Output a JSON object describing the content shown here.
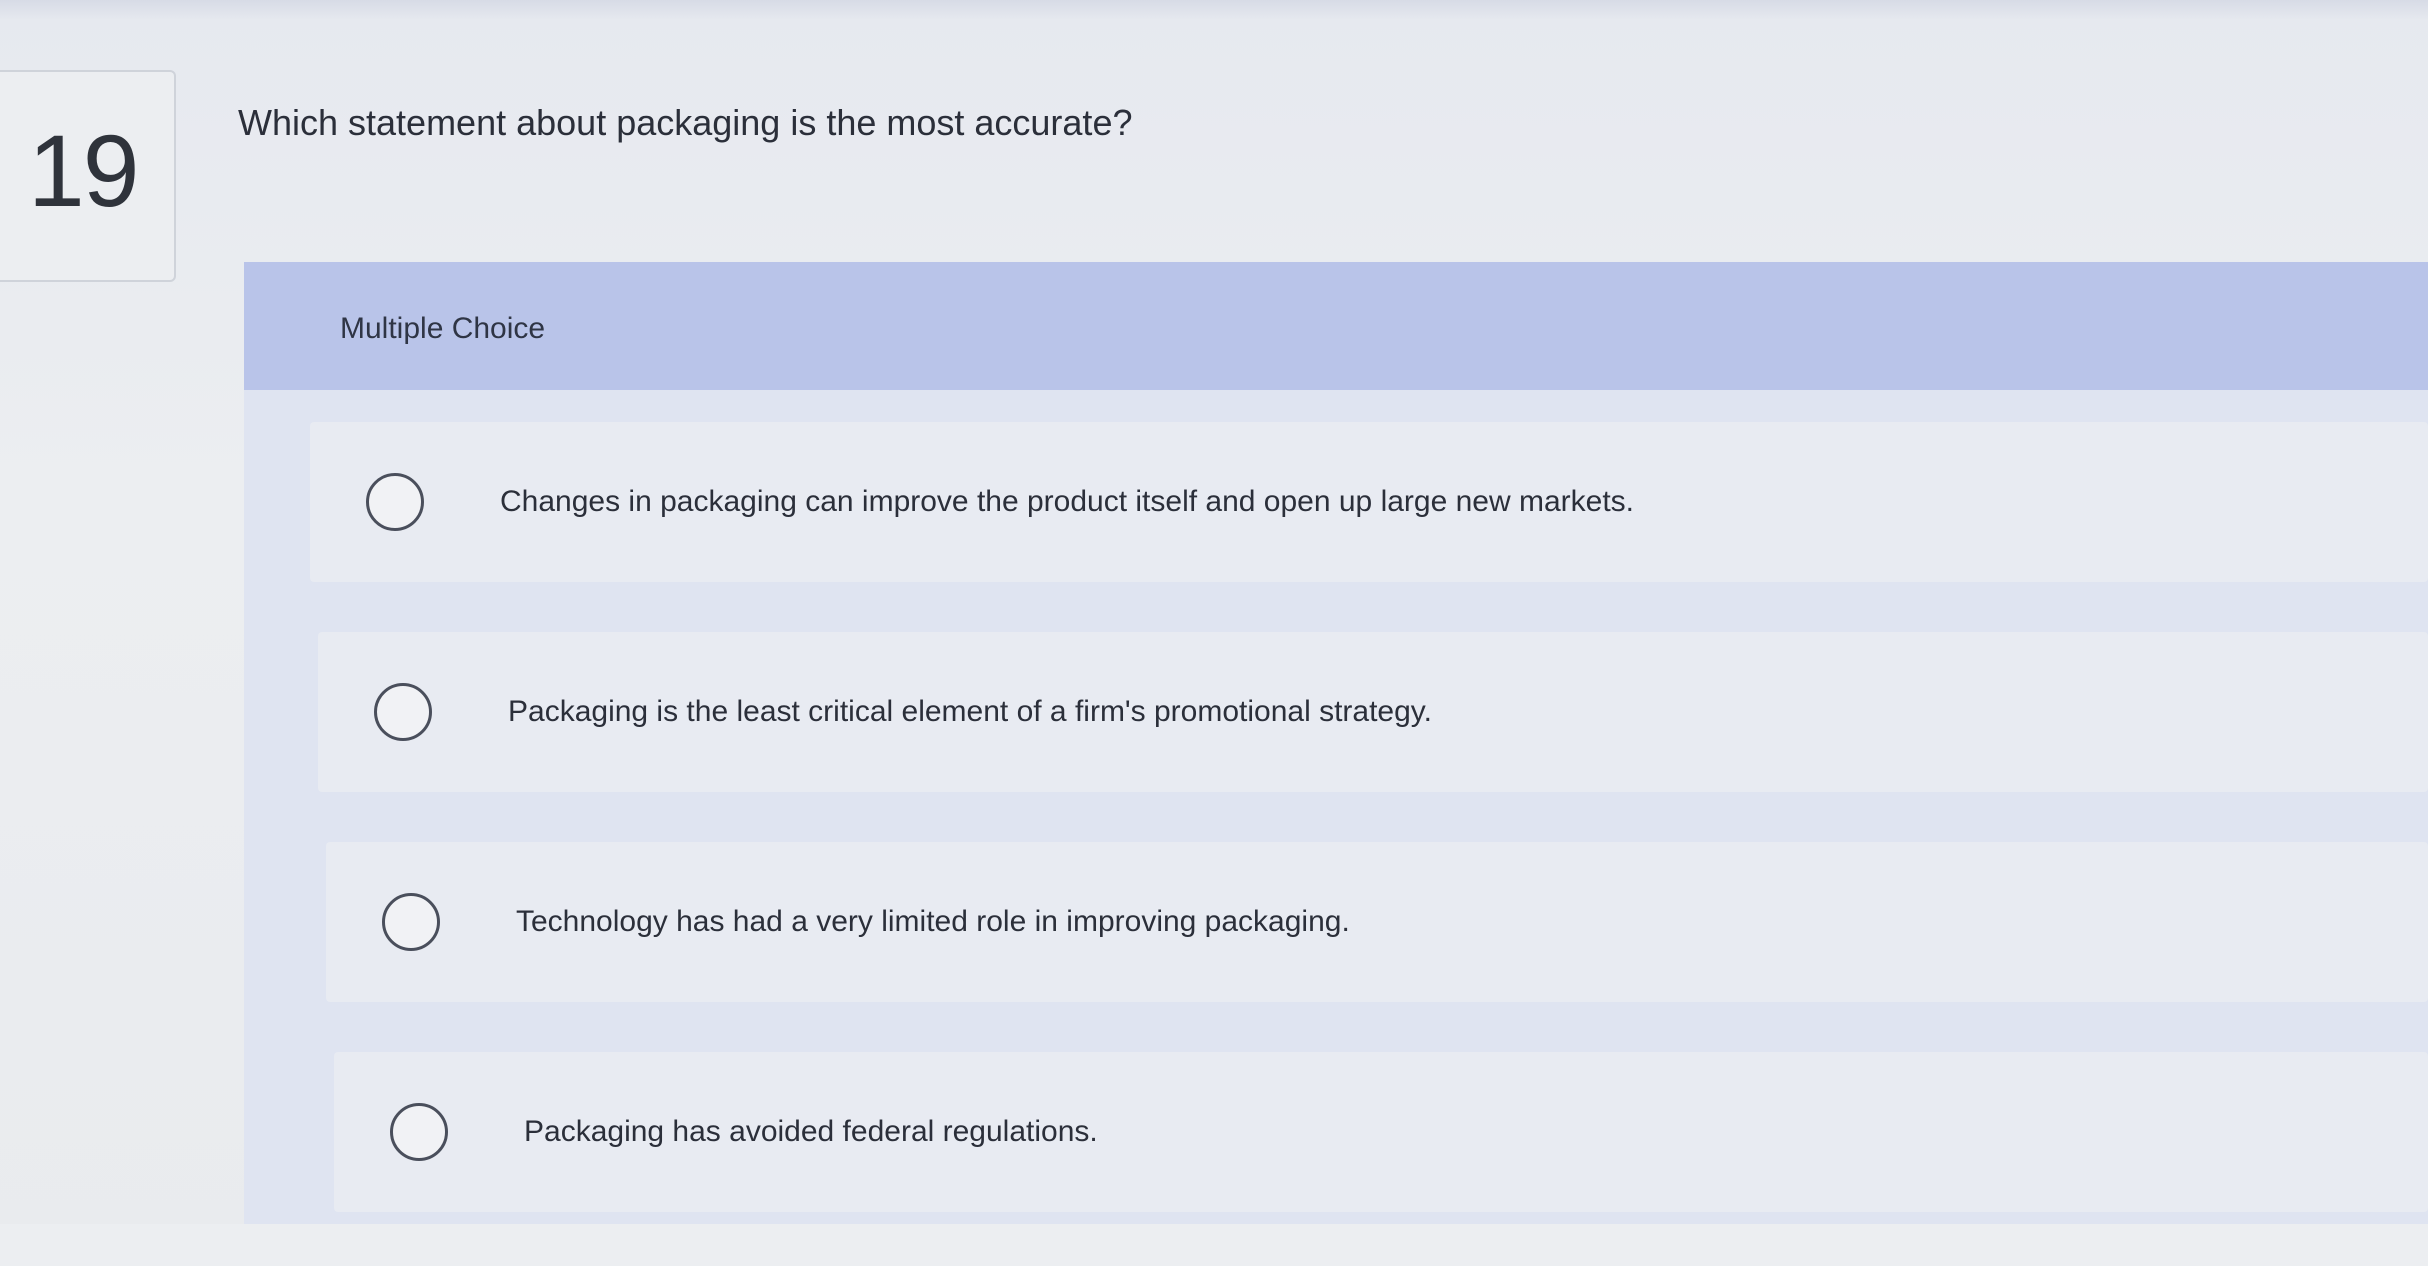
{
  "question": {
    "number": "19",
    "text": "Which statement about packaging is the most accurate?"
  },
  "answer_panel": {
    "type_label": "Multiple Choice",
    "options": [
      {
        "label": "Changes in packaging can improve the product itself and open up large new markets.",
        "selected": false
      },
      {
        "label": "Packaging is the least critical element of a firm's promotional strategy.",
        "selected": false
      },
      {
        "label": "Technology has had a very limited role in improving packaging.",
        "selected": false
      },
      {
        "label": "Packaging has avoided federal regulations.",
        "selected": false
      }
    ]
  },
  "colors": {
    "panel_header": "#b9c4e9",
    "panel_body": "#dfe4f1",
    "option_background": "#e8ebf2",
    "text": "#2b2f3a"
  }
}
